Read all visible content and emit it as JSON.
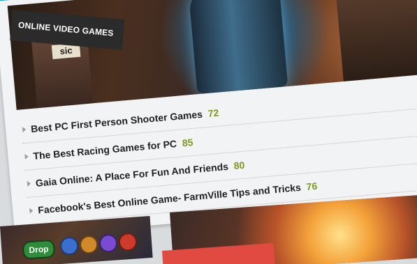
{
  "category": {
    "label": "ONLINE VIDEO GAMES"
  },
  "hero": {
    "sign_text": "sic"
  },
  "articles": [
    {
      "title": "Best PC First Person Shooter Games",
      "count": "72"
    },
    {
      "title": "The Best Racing Games for PC",
      "count": "85"
    },
    {
      "title": "Gaia Online: A Place For Fun And Friends",
      "count": "80"
    },
    {
      "title": "Facebook's Best Online Game- FarmVille Tips and Tricks",
      "count": "76"
    }
  ],
  "thumbnails": {
    "left_badge": "Drop"
  },
  "colors": {
    "accent": "#1ea6d6",
    "score": "#7a9a1f",
    "tag_bg": "#2b2b2b",
    "red_tab": "#e04a40"
  }
}
